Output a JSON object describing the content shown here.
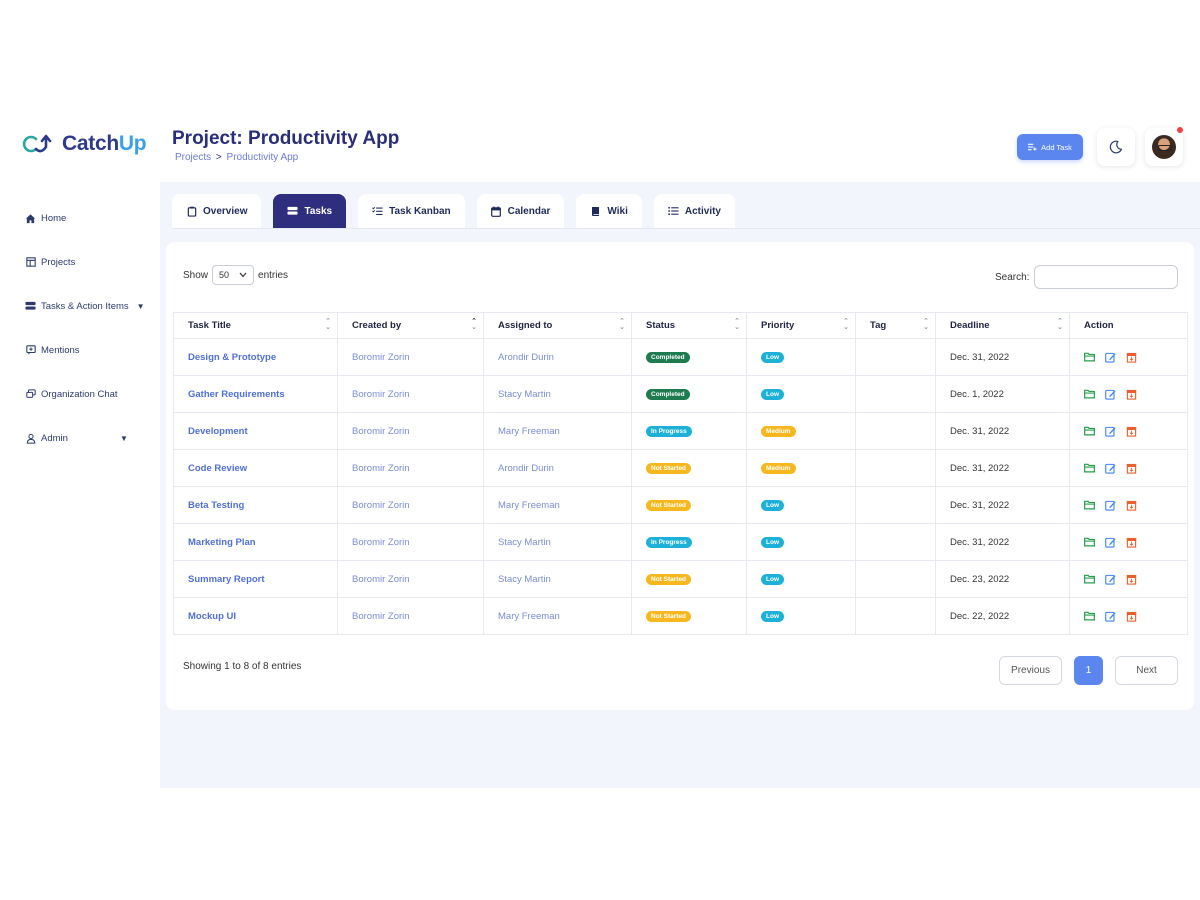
{
  "app": {
    "name_part1": "Catch",
    "name_part2": "Up"
  },
  "colors": {
    "brand": "#2d3a8c",
    "accent": "#5b86f0",
    "tab_active": "#2e2d7e",
    "completed": "#1e7a4f",
    "in_progress": "#1eb1d8",
    "not_started": "#f7b81f",
    "low": "#1eb1d8",
    "medium": "#f7b81f"
  },
  "sidebar": {
    "items": [
      {
        "label": "Home",
        "icon": "home-icon"
      },
      {
        "label": "Projects",
        "icon": "projects-icon"
      },
      {
        "label": "Tasks & Action Items",
        "icon": "tasks-icon"
      },
      {
        "label": "Mentions",
        "icon": "mentions-icon"
      },
      {
        "label": "Organization Chat",
        "icon": "chat-icon"
      },
      {
        "label": "Admin",
        "icon": "user-icon"
      }
    ]
  },
  "header": {
    "title": "Project: Productivity App",
    "breadcrumb": {
      "root": "Projects",
      "sep": ">",
      "current": "Productivity App"
    },
    "add_task_label": "Add Task"
  },
  "tabs": [
    {
      "label": "Overview"
    },
    {
      "label": "Tasks"
    },
    {
      "label": "Task Kanban"
    },
    {
      "label": "Calendar"
    },
    {
      "label": "Wiki"
    },
    {
      "label": "Activity"
    }
  ],
  "table_controls": {
    "show_label": "Show",
    "show_value": "50",
    "entries_label": "entries",
    "search_label": "Search:",
    "search_value": ""
  },
  "columns": [
    "Task Title",
    "Created by",
    "Assigned to",
    "Status",
    "Priority",
    "Tag",
    "Deadline",
    "Action"
  ],
  "rows": [
    {
      "title": "Design & Prototype",
      "created_by": "Boromir Zorin",
      "assigned_to": "Arondir Durin",
      "status": "Completed",
      "priority": "Low",
      "tag": "",
      "deadline": "Dec. 31, 2022"
    },
    {
      "title": "Gather Requirements",
      "created_by": "Boromir Zorin",
      "assigned_to": "Stacy Martin",
      "status": "Completed",
      "priority": "Low",
      "tag": "",
      "deadline": "Dec. 1, 2022"
    },
    {
      "title": "Development",
      "created_by": "Boromir Zorin",
      "assigned_to": "Mary Freeman",
      "status": "In Progress",
      "priority": "Medium",
      "tag": "",
      "deadline": "Dec. 31, 2022"
    },
    {
      "title": "Code Review",
      "created_by": "Boromir Zorin",
      "assigned_to": "Arondir Durin",
      "status": "Not Started",
      "priority": "Medium",
      "tag": "",
      "deadline": "Dec. 31, 2022"
    },
    {
      "title": "Beta Testing",
      "created_by": "Boromir Zorin",
      "assigned_to": "Mary Freeman",
      "status": "Not Started",
      "priority": "Low",
      "tag": "",
      "deadline": "Dec. 31, 2022"
    },
    {
      "title": "Marketing Plan",
      "created_by": "Boromir Zorin",
      "assigned_to": "Stacy Martin",
      "status": "In Progress",
      "priority": "Low",
      "tag": "",
      "deadline": "Dec. 31, 2022"
    },
    {
      "title": "Summary Report",
      "created_by": "Boromir Zorin",
      "assigned_to": "Stacy Martin",
      "status": "Not Started",
      "priority": "Low",
      "tag": "",
      "deadline": "Dec. 23, 2022"
    },
    {
      "title": "Mockup UI",
      "created_by": "Boromir Zorin",
      "assigned_to": "Mary Freeman",
      "status": "Not Started",
      "priority": "Low",
      "tag": "",
      "deadline": "Dec. 22, 2022"
    }
  ],
  "footer": {
    "info": "Showing 1 to 8 of 8 entries",
    "previous": "Previous",
    "page": "1",
    "next": "Next"
  }
}
